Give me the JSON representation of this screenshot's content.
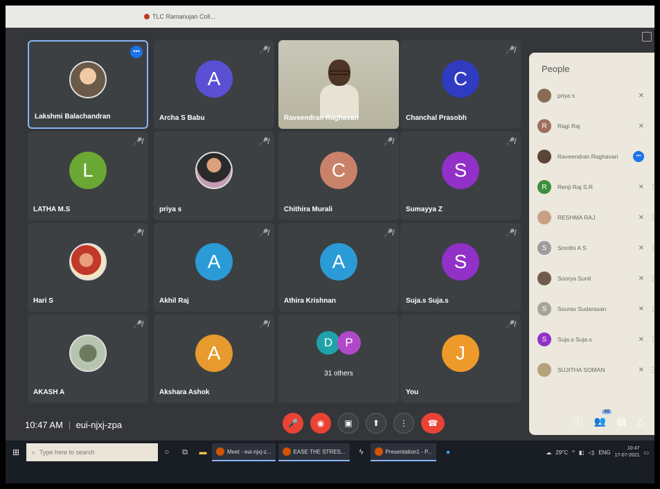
{
  "browser": {
    "bookmarks": [
      "TLC Ramanujan Coll..."
    ]
  },
  "tiles": [
    {
      "name": "Lakshmi Balachandran",
      "kind": "photo",
      "photo": "p1",
      "more": "•••",
      "active": true
    },
    {
      "name": "Archa S Babu",
      "kind": "initial",
      "initial": "A",
      "color": "#5b4fd4"
    },
    {
      "name": "Raveendran Raghavan",
      "kind": "video"
    },
    {
      "name": "Chanchal Prasobh",
      "kind": "initial",
      "initial": "C",
      "color": "#2f3cc2"
    },
    {
      "name": "LATHA M.S",
      "kind": "initial",
      "initial": "L",
      "color": "#6ba833"
    },
    {
      "name": "priya s",
      "kind": "photo",
      "photo": "p2"
    },
    {
      "name": "Chithira Murali",
      "kind": "initial",
      "initial": "C",
      "color": "#c98269"
    },
    {
      "name": "Sumayya Z",
      "kind": "initial",
      "initial": "S",
      "color": "#9131c7"
    },
    {
      "name": "Hari S",
      "kind": "photo",
      "photo": "p3"
    },
    {
      "name": "Akhil Raj",
      "kind": "initial",
      "initial": "A",
      "color": "#2a9bd6"
    },
    {
      "name": "Athira Krishnan",
      "kind": "initial",
      "initial": "A",
      "color": "#2a9bd6"
    },
    {
      "name": "Suja.s Suja.s",
      "kind": "initial",
      "initial": "S",
      "color": "#9131c7"
    },
    {
      "name": "AKASH A",
      "kind": "photo",
      "photo": "p4"
    },
    {
      "name": "Akshara Ashok",
      "kind": "initial",
      "initial": "A",
      "color": "#e79a2d"
    },
    {
      "name": "",
      "kind": "others",
      "label": "31 others",
      "minis": [
        {
          "initial": "D",
          "color": "#1fa3a8"
        },
        {
          "initial": "P",
          "color": "#b049c8"
        }
      ]
    },
    {
      "name": "You",
      "kind": "initial",
      "initial": "J",
      "color": "#ee9a2a"
    }
  ],
  "meeting": {
    "time": "10:47 AM",
    "separator": "|",
    "code": "eui-njxj-zpa"
  },
  "controls": [
    "mic-off",
    "camera-off",
    "captions",
    "present",
    "more",
    "end-call"
  ],
  "people_panel": {
    "title": "People",
    "people": [
      {
        "name": "priya s",
        "initial": "",
        "color": "#8a6b55"
      },
      {
        "name": "Ragi Raj",
        "initial": "R",
        "color": "#9e6f5f"
      },
      {
        "name": "Raveendran Raghavan",
        "initial": "",
        "color": "#5b4537",
        "host": true
      },
      {
        "name": "Renji Raj S.R",
        "initial": "R",
        "color": "#3e8f3e"
      },
      {
        "name": "RESHMA RAJ",
        "initial": "",
        "color": "#c9a086"
      },
      {
        "name": "Smrithi A S",
        "initial": "S",
        "color": "#9c9c9c"
      },
      {
        "name": "Soorya Sunil",
        "initial": "",
        "color": "#6f5b4a"
      },
      {
        "name": "Sourav Sudarasan",
        "initial": "S",
        "color": "#a8a39a"
      },
      {
        "name": "Suja.s Suja.s",
        "initial": "S",
        "color": "#9131c7"
      },
      {
        "name": "SUJITHA SOMAN",
        "initial": "",
        "color": "#b5a27a"
      }
    ]
  },
  "people_count": "46",
  "taskbar": {
    "search_placeholder": "Type here to search",
    "apps": [
      "Meet - eui-njxj-z...",
      "EASE THE STRES...",
      "Presentation1 - P..."
    ],
    "weather": "29°C",
    "lang": "ENG",
    "time": "10:47",
    "date": "17-07-2021"
  }
}
